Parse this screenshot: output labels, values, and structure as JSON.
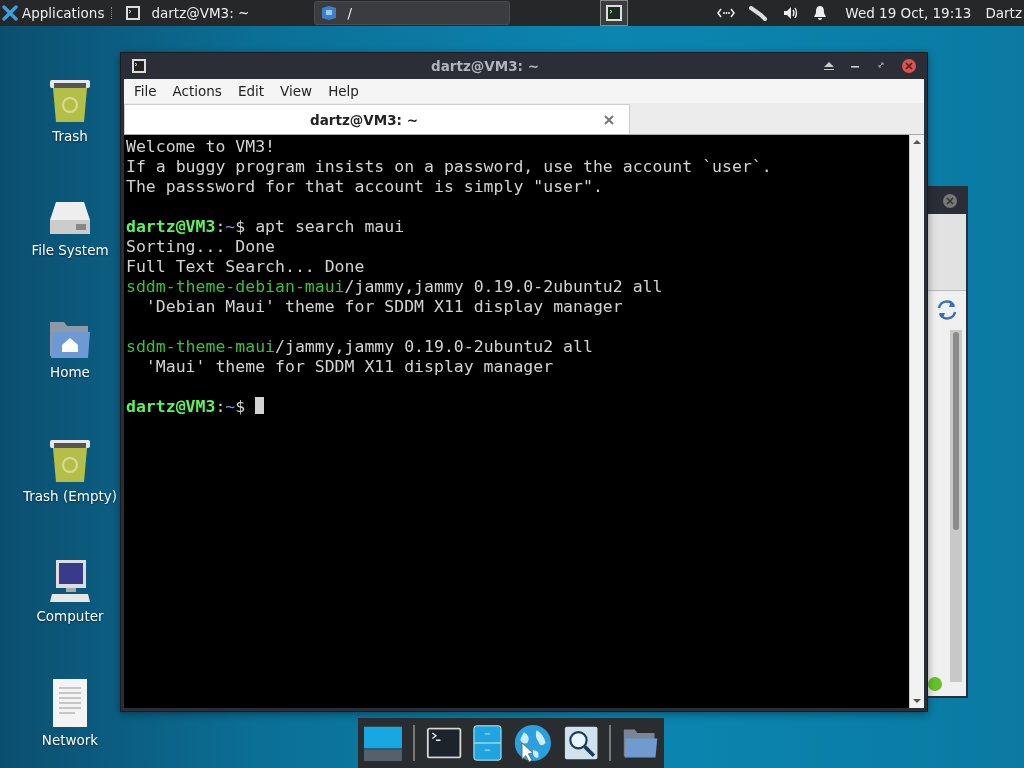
{
  "top_panel": {
    "applications": "Applications",
    "tasks": [
      {
        "label": "dartz@VM3: ~",
        "kind": "terminal",
        "selected": false
      },
      {
        "label": "/",
        "kind": "files",
        "selected": true
      }
    ],
    "clock": "Wed 19 Oct, 19:13",
    "user": "Dartz"
  },
  "desktop_icons": [
    {
      "label": "Trash",
      "kind": "trash"
    },
    {
      "label": "File System",
      "kind": "drive"
    },
    {
      "label": "Home",
      "kind": "home"
    },
    {
      "label": "Trash (Empty)",
      "kind": "trash"
    },
    {
      "label": "Computer",
      "kind": "computer"
    },
    {
      "label": "Network",
      "kind": "document"
    }
  ],
  "terminal_window": {
    "title": "dartz@VM3: ~",
    "menu": [
      "File",
      "Actions",
      "Edit",
      "View",
      "Help"
    ],
    "tab": {
      "label": "dartz@VM3: ~",
      "selected": true
    },
    "blocks": [
      [
        [
          {
            "text": "Welcome to VM3!",
            "kind": "text"
          }
        ],
        [
          {
            "text": "If a buggy program insists on a password, use the account `user`.",
            "kind": "text"
          }
        ],
        [
          {
            "text": "The passsword for that account is simply \"user\".",
            "kind": "text"
          }
        ]
      ],
      [
        [
          {
            "text": "dartz@VM3",
            "kind": "user"
          },
          {
            "text": ":",
            "kind": "text"
          },
          {
            "text": "~",
            "kind": "path"
          },
          {
            "text": "$ apt search maui",
            "kind": "text"
          }
        ],
        [
          {
            "text": "Sorting... Done",
            "kind": "text"
          }
        ],
        [
          {
            "text": "Full Text Search... Done",
            "kind": "text"
          }
        ],
        [
          {
            "text": "sddm-theme-debian-maui",
            "kind": "package"
          },
          {
            "text": "/jammy,jammy 0.19.0-2ubuntu2 all",
            "kind": "text"
          }
        ],
        [
          {
            "text": "  'Debian Maui' theme for SDDM X11 display manager",
            "kind": "text"
          }
        ]
      ],
      [
        [
          {
            "text": "sddm-theme-maui",
            "kind": "package"
          },
          {
            "text": "/jammy,jammy 0.19.0-2ubuntu2 all",
            "kind": "text"
          }
        ],
        [
          {
            "text": "  'Maui' theme for SDDM X11 display manager",
            "kind": "text"
          }
        ]
      ],
      [
        [
          {
            "text": "dartz@VM3",
            "kind": "user"
          },
          {
            "text": ":",
            "kind": "text"
          },
          {
            "text": "~",
            "kind": "path"
          },
          {
            "text": "$ ",
            "kind": "text"
          }
        ]
      ]
    ],
    "cursor": true
  },
  "dock": [
    {
      "kind": "workspace"
    },
    {
      "kind": "separator"
    },
    {
      "kind": "terminal"
    },
    {
      "kind": "cabinet"
    },
    {
      "kind": "globe"
    },
    {
      "kind": "search"
    },
    {
      "kind": "separator"
    },
    {
      "kind": "folder"
    }
  ]
}
